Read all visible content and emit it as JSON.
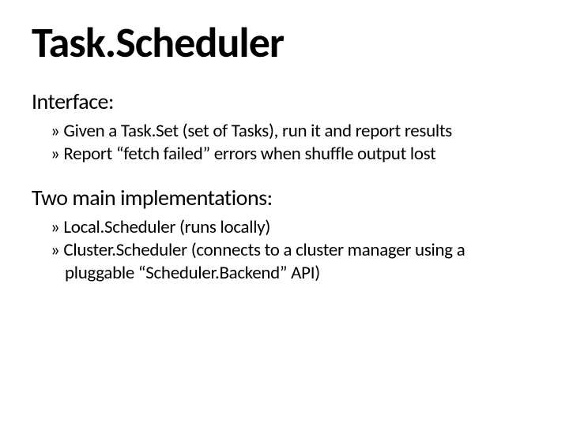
{
  "title": "Task.Scheduler",
  "sections": [
    {
      "label": "Interface:",
      "items": [
        "Given a Task.Set (set of Tasks), run it and report results",
        "Report “fetch failed” errors when shuffle output lost"
      ]
    },
    {
      "label": "Two main implementations:",
      "items": [
        "Local.Scheduler (runs locally)",
        "Cluster.Scheduler (connects to a cluster manager using a pluggable “Scheduler.Backend” API)"
      ]
    }
  ],
  "bullet_glyph": "»"
}
